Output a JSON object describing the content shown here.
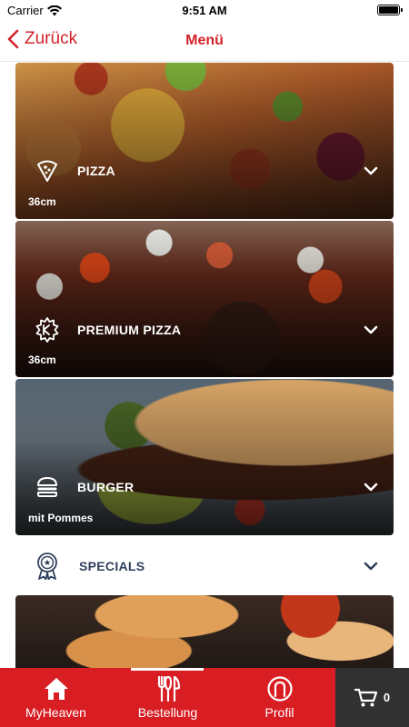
{
  "status_bar": {
    "carrier": "Carrier",
    "time": "9:51 AM"
  },
  "nav": {
    "back_label": "Zurück",
    "title": "Menü",
    "accent": "#d2232a"
  },
  "categories": [
    {
      "title": "PIZZA",
      "subtitle": "36cm",
      "icon": "pizza-slice-icon"
    },
    {
      "title": "PREMIUM PIZZA",
      "subtitle": "36cm",
      "icon": "premium-badge-icon"
    },
    {
      "title": "BURGER",
      "subtitle": "mit Pommes",
      "icon": "burger-icon"
    },
    {
      "title": "SPECIALS",
      "subtitle": "",
      "icon": "award-icon"
    }
  ],
  "tab_bar": {
    "items": [
      {
        "label": "MyHeaven",
        "icon": "home-icon"
      },
      {
        "label": "Bestellung",
        "icon": "cutlery-icon",
        "selected": true
      },
      {
        "label": "Profil",
        "icon": "profile-icon"
      }
    ],
    "cart_count": "0",
    "background": "#d81e23",
    "cart_background": "#313131"
  }
}
